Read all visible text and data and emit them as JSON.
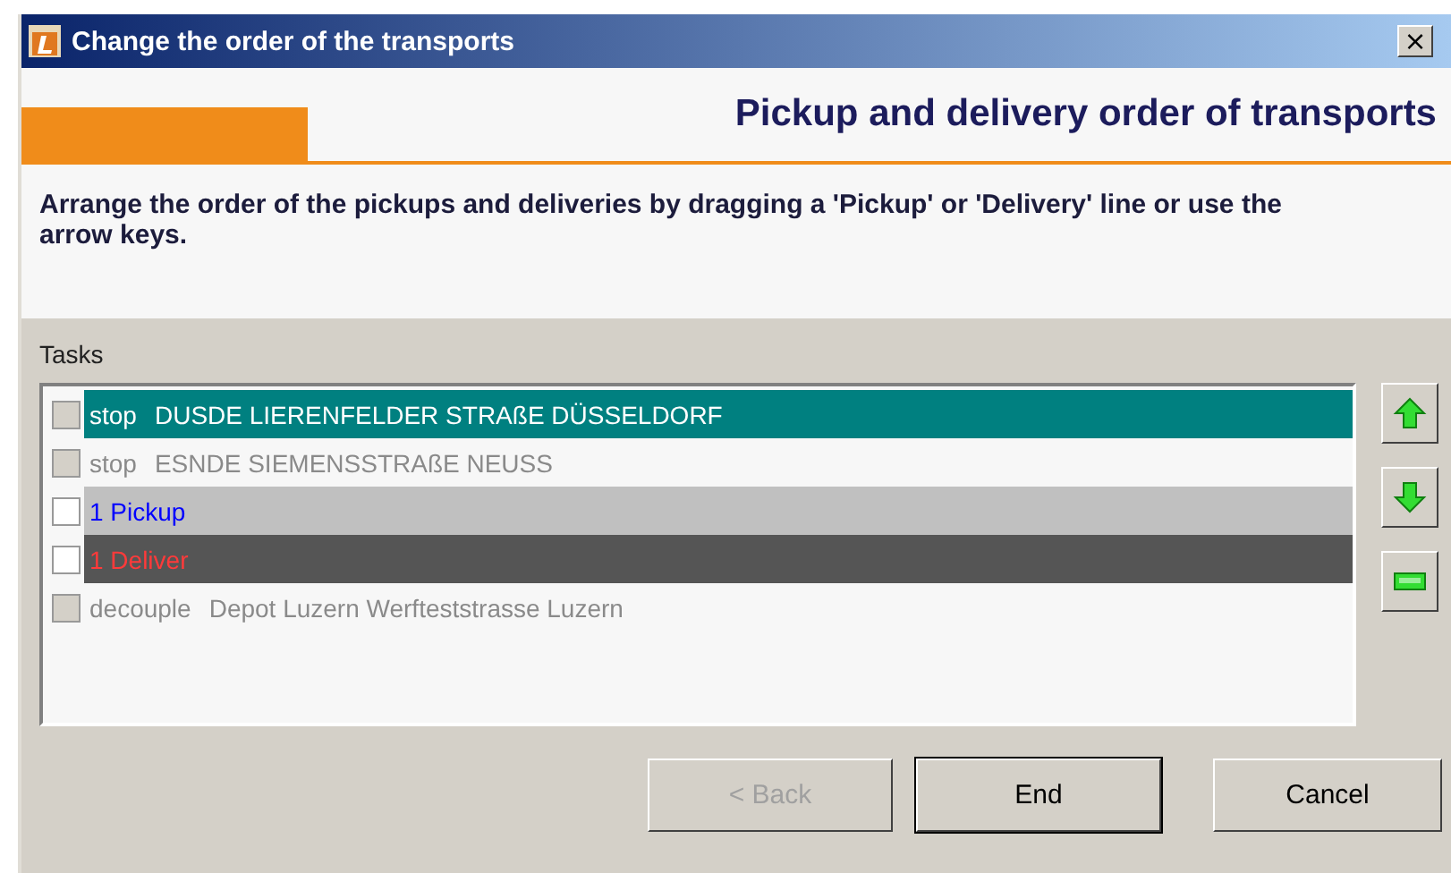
{
  "window": {
    "title": "Change the order of the transports",
    "close": "×"
  },
  "header": {
    "title": "Pickup and delivery order of transports",
    "instructions": "Arrange the order of the pickups and deliveries by dragging a 'Pickup' or 'Delivery' line or use the arrow keys."
  },
  "tasks": {
    "label": "Tasks",
    "rows": [
      {
        "kind": "stop",
        "action": "stop",
        "place": "DUSDE LIERENFELDER STRAßE DÜSSELDORF",
        "selected": true,
        "disabled": true,
        "checked": false
      },
      {
        "kind": "stop",
        "action": "stop",
        "place": "ESNDE SIEMENSSTRAßE NEUSS",
        "selected": false,
        "disabled": true,
        "checked": false
      },
      {
        "kind": "pickup",
        "action": "1 Pickup",
        "selected": false,
        "disabled": false,
        "checked": false
      },
      {
        "kind": "deliver",
        "action": "1 Deliver",
        "selected": false,
        "disabled": false,
        "checked": false
      },
      {
        "kind": "decouple",
        "action": "decouple",
        "place": "Depot Luzern Werfteststrasse Luzern",
        "selected": false,
        "disabled": true,
        "checked": false
      }
    ]
  },
  "side_buttons": [
    {
      "kind": "up"
    },
    {
      "kind": "down"
    },
    {
      "kind": "block"
    }
  ],
  "buttons": [
    {
      "label": "< Back",
      "disabled": true,
      "default": false
    },
    {
      "label": "End",
      "disabled": false,
      "default": true
    },
    {
      "label": "Cancel",
      "disabled": false,
      "default": false
    }
  ]
}
